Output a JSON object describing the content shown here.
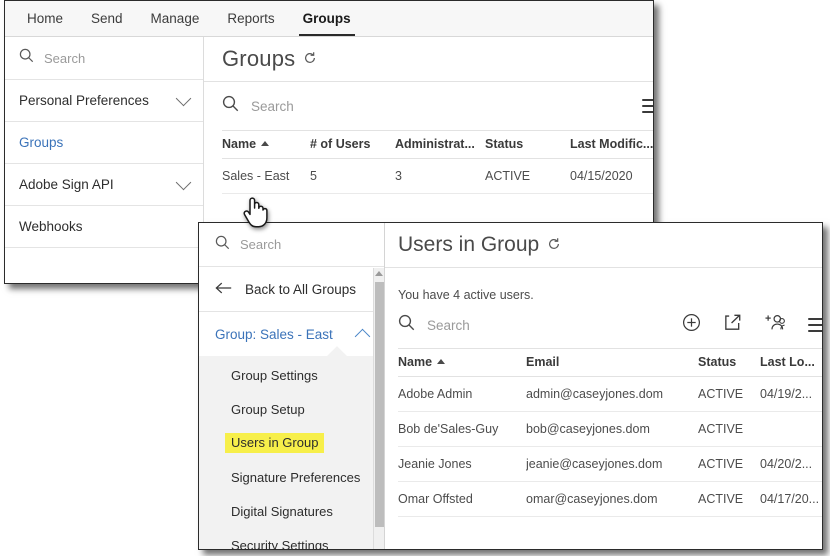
{
  "window_groups": {
    "topnav": {
      "items": [
        {
          "label": "Home",
          "active": false
        },
        {
          "label": "Send",
          "active": false
        },
        {
          "label": "Manage",
          "active": false
        },
        {
          "label": "Reports",
          "active": false
        },
        {
          "label": "Groups",
          "active": true
        }
      ]
    },
    "sidebar": {
      "search_placeholder": "Search",
      "items": [
        {
          "label": "Personal Preferences",
          "chevron": true,
          "link": false
        },
        {
          "label": "Groups",
          "chevron": false,
          "link": true
        },
        {
          "label": "Adobe Sign API",
          "chevron": true,
          "link": false
        },
        {
          "label": "Webhooks",
          "chevron": false,
          "link": false
        }
      ]
    },
    "page_title": "Groups",
    "refresh_icon": "refresh-icon",
    "toolbar": {
      "search_placeholder": "Search",
      "menu_icon": "hamburger-icon"
    },
    "table": {
      "columns": [
        "Name",
        "# of Users",
        "Administrat...",
        "Status",
        "Last Modific..."
      ],
      "sorted_column": "Name",
      "sort_direction": "asc",
      "rows": [
        {
          "name": "Sales - East",
          "users": "5",
          "administrators": "3",
          "status": "ACTIVE",
          "last_modified": "04/15/2020"
        }
      ]
    }
  },
  "window_users": {
    "sidebar": {
      "search_placeholder": "Search",
      "back_label": "Back to All Groups",
      "back_icon": "arrow-left-icon",
      "group_label": "Group: Sales - East",
      "group_chevron": "chevron-up-icon",
      "submenu": [
        {
          "label": "Group Settings",
          "selected": false
        },
        {
          "label": "Group Setup",
          "selected": false
        },
        {
          "label": "Users in Group",
          "selected": true
        },
        {
          "label": "Signature Preferences",
          "selected": false
        },
        {
          "label": "Digital Signatures",
          "selected": false
        },
        {
          "label": "Security Settings",
          "selected": false
        }
      ],
      "highlight_color": "#f7ef4a"
    },
    "page_title": "Users in Group",
    "refresh_icon": "refresh-icon",
    "status_text": "You have 4 active users.",
    "toolbar": {
      "search_placeholder": "Search",
      "icons": [
        "add-circle-icon",
        "export-icon",
        "add-users-icon",
        "hamburger-icon"
      ]
    },
    "table": {
      "columns": [
        "Name",
        "Email",
        "Status",
        "Last Lo..."
      ],
      "sorted_column": "Name",
      "sort_direction": "asc",
      "rows": [
        {
          "name": "Adobe Admin",
          "email": "admin@caseyjones.dom",
          "status": "ACTIVE",
          "last_login": "04/19/2..."
        },
        {
          "name": "Bob de'Sales-Guy",
          "email": "bob@caseyjones.dom",
          "status": "ACTIVE",
          "last_login": ""
        },
        {
          "name": "Jeanie Jones",
          "email": "jeanie@caseyjones.dom",
          "status": "ACTIVE",
          "last_login": "04/20/2..."
        },
        {
          "name": "Omar Offsted",
          "email": "omar@caseyjones.dom",
          "status": "ACTIVE",
          "last_login": "04/17/20..."
        }
      ]
    }
  },
  "cursor": {
    "icon": "pointing-hand-cursor"
  },
  "colors": {
    "link": "#3b73b9",
    "highlight": "#f7ef4a",
    "text": "#2d2d2d",
    "muted": "#9a9a9a"
  }
}
